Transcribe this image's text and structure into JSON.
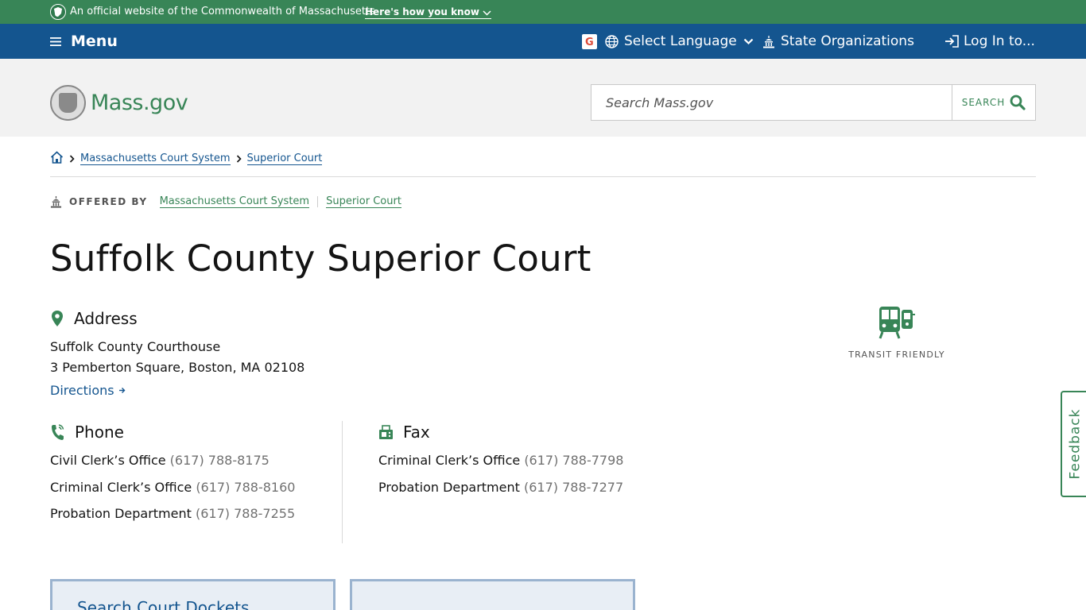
{
  "official_bar": {
    "text": "An official website of the Commonwealth of Massachusetts",
    "link": "Here's how you know"
  },
  "utility_nav": {
    "menu_label": "Menu",
    "language_label": "Select Language",
    "state_orgs_label": "State Organizations",
    "login_label": "Log In to..."
  },
  "header": {
    "logo_text": "Mass.gov",
    "search_placeholder": "Search Mass.gov",
    "search_button": "SEARCH"
  },
  "breadcrumb": {
    "items": [
      "Massachusetts Court System",
      "Superior Court"
    ]
  },
  "offered_by": {
    "label": "OFFERED BY",
    "orgs": [
      "Massachusetts Court System",
      "Superior Court"
    ]
  },
  "page": {
    "title": "Suffolk County Superior Court"
  },
  "address": {
    "heading": "Address",
    "line1": "Suffolk County Courthouse",
    "line2": "3 Pemberton Square, Boston, MA 02108",
    "directions": "Directions"
  },
  "phone": {
    "heading": "Phone",
    "entries": [
      {
        "name": "Civil Clerk’s Office",
        "number": "(617) 788-8175"
      },
      {
        "name": "Criminal Clerk’s Office",
        "number": "(617) 788-8160"
      },
      {
        "name": "Probation Department",
        "number": "(617) 788-7255"
      }
    ]
  },
  "fax": {
    "heading": "Fax",
    "entries": [
      {
        "name": "Criminal Clerk’s Office",
        "number": "(617) 788-7798"
      },
      {
        "name": "Probation Department",
        "number": "(617) 788-7277"
      }
    ]
  },
  "transit": {
    "label": "TRANSIT FRIENDLY"
  },
  "feedback": {
    "label": "Feedback"
  },
  "cards": [
    {
      "title": "Search Court Dockets"
    },
    {
      "title": ""
    }
  ],
  "colors": {
    "green": "#388557",
    "blue": "#14558f",
    "header_gray": "#f2f2f2"
  }
}
